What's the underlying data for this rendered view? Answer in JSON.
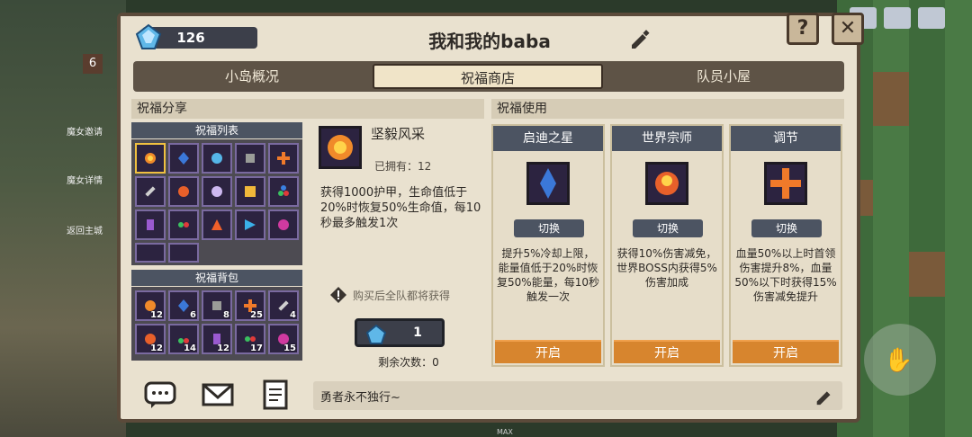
{
  "currency": {
    "amount": "126"
  },
  "title": "我和我的baba",
  "tabs": [
    "小岛概况",
    "祝福商店",
    "队员小屋"
  ],
  "left_section": {
    "label": "祝福分享",
    "list_header": "祝福列表",
    "bag_header": "祝福背包",
    "bag_counts": [
      "12",
      "6",
      "8",
      "25",
      "4",
      "12",
      "14",
      "12",
      "17",
      "15"
    ]
  },
  "detail": {
    "name": "坚毅风采",
    "owned": "已拥有：12",
    "desc": "获得1000护甲，生命值低于20%时恢复50%生命值，每10秒最多触发1次",
    "hint": "购买后全队都将获得",
    "price": "1",
    "remain": "剩余次数：0"
  },
  "right_section": {
    "label": "祝福使用",
    "cards": [
      {
        "name": "启迪之星",
        "switch": "切换",
        "desc": "提升5%冷却上限，能量值低于20%时恢复50%能量，每10秒触发一次",
        "open": "开启"
      },
      {
        "name": "世界宗师",
        "switch": "切换",
        "desc": "获得10%伤害减免，世界BOSS内获得5%伤害加成",
        "open": "开启"
      },
      {
        "name": "调节",
        "switch": "切换",
        "desc": "血量50%以上时首领伤害提升8%，血量50%以下时获得15%伤害减免提升",
        "open": "开启"
      }
    ]
  },
  "footer": {
    "message": "勇者永不独行~"
  },
  "side_labels": [
    "魔女邀请",
    "魔女详情",
    "返回主城"
  ],
  "house_number": "6",
  "max_label": "MAX",
  "colors": {
    "accent": "#d7852e",
    "header": "#4c5462",
    "panel": "#e9e1cf"
  }
}
